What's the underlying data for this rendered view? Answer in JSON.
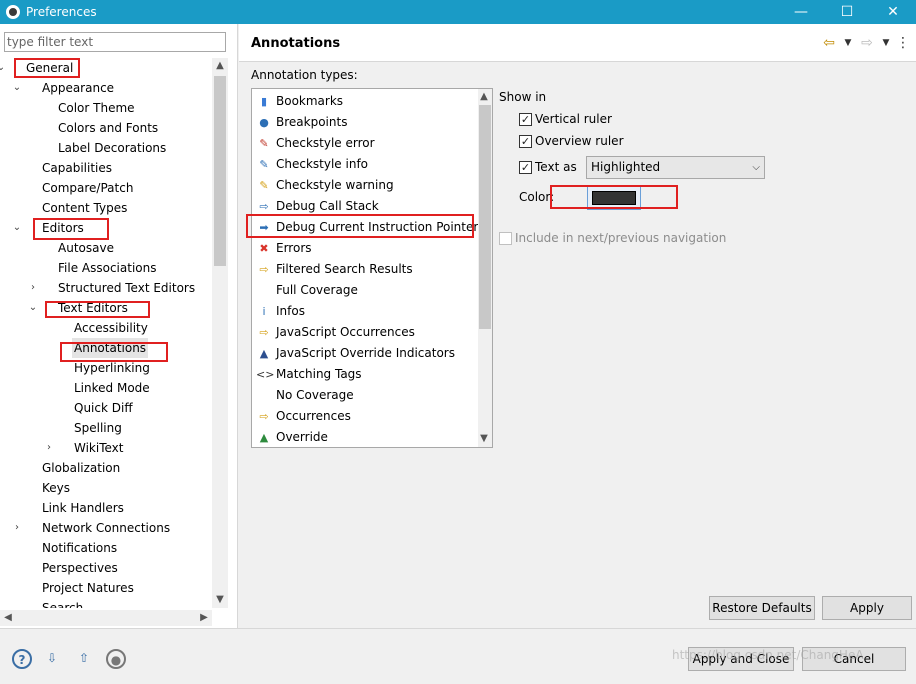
{
  "window": {
    "title": "Preferences",
    "minimize_glyph": "—",
    "maximize_glyph": "☐",
    "close_glyph": "✕"
  },
  "filter": {
    "placeholder": "type filter text"
  },
  "tree": {
    "items": [
      {
        "label": "General",
        "indent": 0,
        "twisty": "v"
      },
      {
        "label": "Appearance",
        "indent": 1,
        "twisty": "v"
      },
      {
        "label": "Color Theme",
        "indent": 2,
        "twisty": ""
      },
      {
        "label": "Colors and Fonts",
        "indent": 2,
        "twisty": ""
      },
      {
        "label": "Label Decorations",
        "indent": 2,
        "twisty": ""
      },
      {
        "label": "Capabilities",
        "indent": 1,
        "twisty": ""
      },
      {
        "label": "Compare/Patch",
        "indent": 1,
        "twisty": ""
      },
      {
        "label": "Content Types",
        "indent": 1,
        "twisty": ""
      },
      {
        "label": "Editors",
        "indent": 1,
        "twisty": "v"
      },
      {
        "label": "Autosave",
        "indent": 2,
        "twisty": ""
      },
      {
        "label": "File Associations",
        "indent": 2,
        "twisty": ""
      },
      {
        "label": "Structured Text Editors",
        "indent": 2,
        "twisty": ">"
      },
      {
        "label": "Text Editors",
        "indent": 2,
        "twisty": "v"
      },
      {
        "label": "Accessibility",
        "indent": 3,
        "twisty": ""
      },
      {
        "label": "Annotations",
        "indent": 3,
        "twisty": "",
        "selected": true
      },
      {
        "label": "Hyperlinking",
        "indent": 3,
        "twisty": ""
      },
      {
        "label": "Linked Mode",
        "indent": 3,
        "twisty": ""
      },
      {
        "label": "Quick Diff",
        "indent": 3,
        "twisty": ""
      },
      {
        "label": "Spelling",
        "indent": 3,
        "twisty": ""
      },
      {
        "label": "WikiText",
        "indent": 3,
        "twisty": ">"
      },
      {
        "label": "Globalization",
        "indent": 1,
        "twisty": ""
      },
      {
        "label": "Keys",
        "indent": 1,
        "twisty": ""
      },
      {
        "label": "Link Handlers",
        "indent": 1,
        "twisty": ""
      },
      {
        "label": "Network Connections",
        "indent": 1,
        "twisty": ">"
      },
      {
        "label": "Notifications",
        "indent": 1,
        "twisty": ""
      },
      {
        "label": "Perspectives",
        "indent": 1,
        "twisty": ""
      },
      {
        "label": "Project Natures",
        "indent": 1,
        "twisty": ""
      },
      {
        "label": "Search",
        "indent": 1,
        "twisty": ""
      }
    ]
  },
  "page": {
    "title": "Annotations",
    "annotation_types_label": "Annotation types:",
    "annotation_types": [
      {
        "label": "Bookmarks",
        "icon": "bookmark-icon",
        "glyph": "▮",
        "color": "#3a7bd5"
      },
      {
        "label": "Breakpoints",
        "icon": "breakpoint-icon",
        "glyph": "●",
        "color": "#2d6fb5"
      },
      {
        "label": "Checkstyle error",
        "icon": "checkstyle-error-icon",
        "glyph": "✎",
        "color": "#c0392b"
      },
      {
        "label": "Checkstyle info",
        "icon": "checkstyle-info-icon",
        "glyph": "✎",
        "color": "#2d6fb5"
      },
      {
        "label": "Checkstyle warning",
        "icon": "checkstyle-warning-icon",
        "glyph": "✎",
        "color": "#d4a017"
      },
      {
        "label": "Debug Call Stack",
        "icon": "debug-call-stack-icon",
        "glyph": "⇨",
        "color": "#2d6fb5"
      },
      {
        "label": "Debug Current Instruction Pointer",
        "icon": "instruction-pointer-icon",
        "glyph": "➡",
        "color": "#2d6fb5"
      },
      {
        "label": "Errors",
        "icon": "error-icon",
        "glyph": "✖",
        "color": "#d9342b"
      },
      {
        "label": "Filtered Search Results",
        "icon": "search-result-icon",
        "glyph": "⇨",
        "color": "#d4a017"
      },
      {
        "label": "Full Coverage",
        "icon": "blank-icon",
        "glyph": "",
        "color": "#000000"
      },
      {
        "label": "Infos",
        "icon": "info-icon",
        "glyph": "i",
        "color": "#2d6fb5"
      },
      {
        "label": "JavaScript Occurrences",
        "icon": "occurrence-icon",
        "glyph": "⇨",
        "color": "#d4a017"
      },
      {
        "label": "JavaScript Override Indicators",
        "icon": "override-indicator-icon",
        "glyph": "▲",
        "color": "#2d4f8f"
      },
      {
        "label": "Matching Tags",
        "icon": "matching-tags-icon",
        "glyph": "<>",
        "color": "#333333"
      },
      {
        "label": "No Coverage",
        "icon": "blank-icon",
        "glyph": "",
        "color": "#000000"
      },
      {
        "label": "Occurrences",
        "icon": "occurrence-icon",
        "glyph": "⇨",
        "color": "#d4a017"
      },
      {
        "label": "Override",
        "icon": "override-icon",
        "glyph": "▲",
        "color": "#2e8b3e"
      }
    ],
    "show_in_label": "Show in",
    "vertical_ruler": {
      "label": "Vertical ruler",
      "checked": true
    },
    "overview_ruler": {
      "label": "Overview ruler",
      "checked": true
    },
    "text_as": {
      "label": "Text as",
      "checked": true,
      "value": "Highlighted"
    },
    "color_label": "Color:",
    "color_value": "#333333",
    "include_nav": {
      "label": "Include in next/previous navigation",
      "checked": false
    },
    "restore_defaults": "Restore Defaults",
    "apply": "Apply"
  },
  "footer": {
    "apply_and_close": "Apply and Close",
    "cancel": "Cancel",
    "watermark": "https://blog.csdn.net/ChangHeA"
  }
}
